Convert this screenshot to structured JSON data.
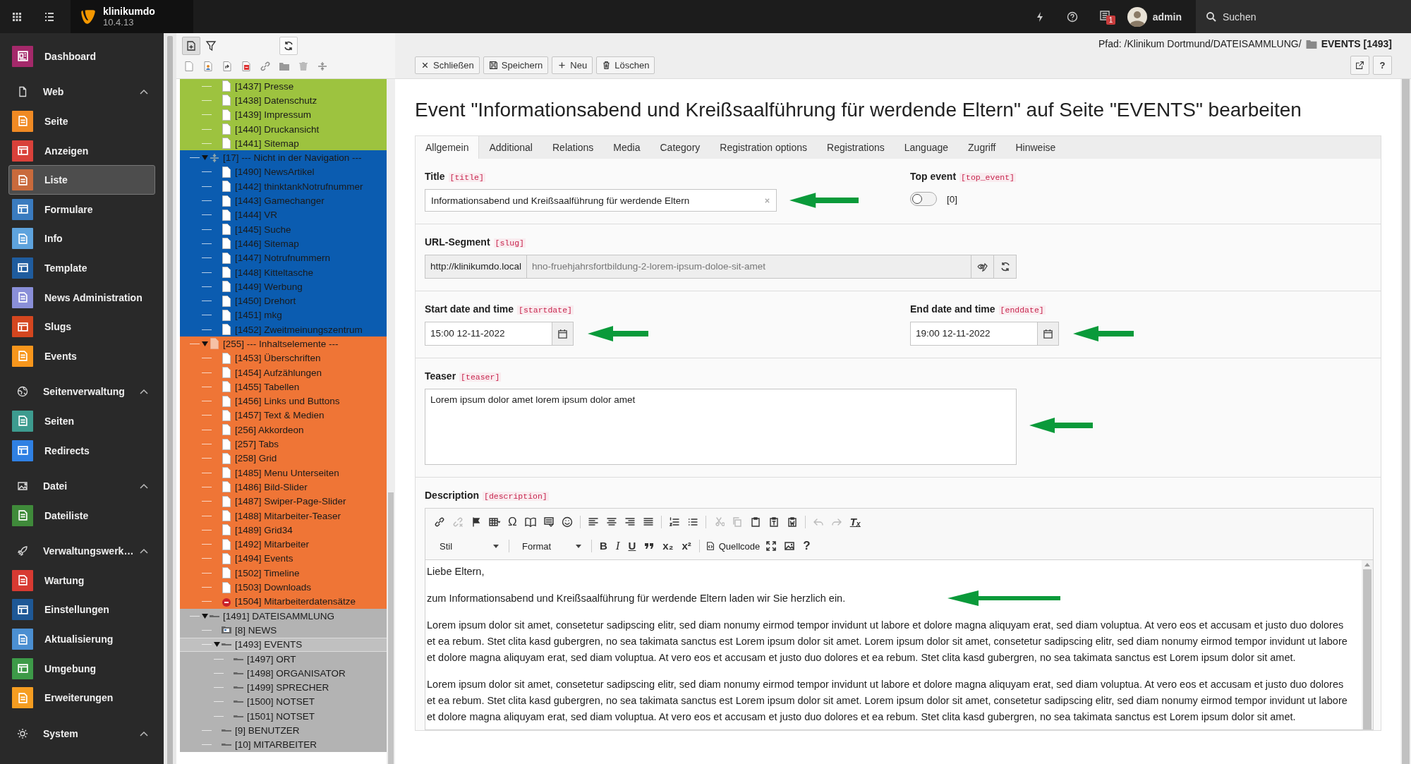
{
  "topbar": {
    "site_name": "klinikumdo",
    "version": "10.4.13",
    "notification_count": "1",
    "user": "admin",
    "search": "Suchen"
  },
  "sidebar": {
    "items": [
      {
        "kind": "module",
        "label": "Dashboard",
        "color": "#a4296a",
        "selected": false
      },
      {
        "kind": "group",
        "label": "Web",
        "expanded": true,
        "children": [
          {
            "label": "Seite",
            "color": "#f08a24",
            "selected": false
          },
          {
            "label": "Anzeigen",
            "color": "#d9413a",
            "selected": false
          },
          {
            "label": "Liste",
            "color": "#c96a3c",
            "selected": true
          },
          {
            "label": "Formulare",
            "color": "#3a7bbf",
            "selected": false
          },
          {
            "label": "Info",
            "color": "#5ea3dd",
            "selected": false
          },
          {
            "label": "Template",
            "color": "#1f5c9e",
            "selected": false
          },
          {
            "label": "News Administration",
            "color": "#8a8fd8",
            "selected": false
          },
          {
            "label": "Slugs",
            "color": "#d4461f",
            "selected": false
          },
          {
            "label": "Events",
            "color": "#f7961c",
            "selected": false
          }
        ]
      },
      {
        "kind": "group",
        "label": "Seitenverwaltung",
        "expanded": true,
        "children": [
          {
            "label": "Seiten",
            "color": "#3d9b8f",
            "selected": false
          },
          {
            "label": "Redirects",
            "color": "#2f80e3",
            "selected": false
          }
        ]
      },
      {
        "kind": "group",
        "label": "Datei",
        "expanded": true,
        "children": [
          {
            "label": "Dateiliste",
            "color": "#3f8a3a",
            "selected": false
          }
        ]
      },
      {
        "kind": "group",
        "label": "Verwaltungswerk…",
        "expanded": true,
        "children": [
          {
            "label": "Wartung",
            "color": "#d73a32",
            "selected": false
          },
          {
            "label": "Einstellungen",
            "color": "#1e5896",
            "selected": false
          },
          {
            "label": "Aktualisierung",
            "color": "#4b8fd1",
            "selected": false
          },
          {
            "label": "Umgebung",
            "color": "#3d9a48",
            "selected": false
          },
          {
            "label": "Erweiterungen",
            "color": "#f59d21",
            "selected": false
          }
        ]
      },
      {
        "kind": "group",
        "label": "System",
        "expanded": true
      }
    ]
  },
  "tree": {
    "cut_branch": {
      "color": "#9dc33f",
      "children": [
        {
          "label": "[1437] Presse",
          "kind": "page",
          "selected": false
        },
        {
          "label": "[1438] Datenschutz",
          "kind": "page",
          "selected": false
        },
        {
          "label": "[1439] Impressum",
          "kind": "page",
          "selected": false
        },
        {
          "label": "[1440] Druckansicht",
          "kind": "page",
          "selected": false
        },
        {
          "label": "[1441] Sitemap",
          "kind": "page",
          "selected": false
        }
      ]
    },
    "nodes": [
      {
        "label": "[17] --- Nicht in der Navigation ---",
        "kind": "spacer",
        "color": "#0b5cb0",
        "expanded": true,
        "selected": false,
        "children": [
          {
            "label": "[1490] NewsArtikel",
            "kind": "page",
            "selected": false
          },
          {
            "label": "[1442] thinktankNotrufnummer",
            "kind": "page",
            "selected": false
          },
          {
            "label": "[1443] Gamechanger",
            "kind": "page",
            "selected": false
          },
          {
            "label": "[1444] VR",
            "kind": "page",
            "selected": false
          },
          {
            "label": "[1445] Suche",
            "kind": "page",
            "selected": false
          },
          {
            "label": "[1446] Sitemap",
            "kind": "page",
            "selected": false
          },
          {
            "label": "[1447] Notrufnummern",
            "kind": "page",
            "selected": false
          },
          {
            "label": "[1448] Kitteltasche",
            "kind": "page",
            "selected": false
          },
          {
            "label": "[1449] Werbung",
            "kind": "page",
            "selected": false
          },
          {
            "label": "[1450] Drehort",
            "kind": "page",
            "selected": false
          },
          {
            "label": "[1451] mkg",
            "kind": "page",
            "selected": false
          },
          {
            "label": "[1452] Zweitmeinungszentrum",
            "kind": "page",
            "selected": false
          }
        ]
      },
      {
        "label": "[255] --- Inhaltselemente ---",
        "kind": "tinted",
        "color": "#ef7536",
        "expanded": true,
        "selected": false,
        "children": [
          {
            "label": "[1453] Überschriften",
            "kind": "page",
            "selected": false
          },
          {
            "label": "[1454] Aufzählungen",
            "kind": "page",
            "selected": false
          },
          {
            "label": "[1455] Tabellen",
            "kind": "page",
            "selected": false
          },
          {
            "label": "[1456] Links und Buttons",
            "kind": "page",
            "selected": false
          },
          {
            "label": "[1457] Text & Medien",
            "kind": "page",
            "selected": false
          },
          {
            "label": "[256] Akkordeon",
            "kind": "page",
            "selected": false
          },
          {
            "label": "[257] Tabs",
            "kind": "page",
            "selected": false
          },
          {
            "label": "[258] Grid",
            "kind": "page",
            "selected": false
          },
          {
            "label": "[1485] Menu Unterseiten",
            "kind": "page",
            "selected": false
          },
          {
            "label": "[1486] Bild-Slider",
            "kind": "page",
            "selected": false
          },
          {
            "label": "[1487] Swiper-Page-Slider",
            "kind": "page",
            "selected": false
          },
          {
            "label": "[1488] Mitarbeiter-Teaser",
            "kind": "page",
            "selected": false
          },
          {
            "label": "[1489] Grid34",
            "kind": "page",
            "selected": false
          },
          {
            "label": "[1492] Mitarbeiter",
            "kind": "page",
            "selected": false
          },
          {
            "label": "[1494] Events",
            "kind": "page",
            "selected": false
          },
          {
            "label": "[1502] Timeline",
            "kind": "page",
            "selected": false
          },
          {
            "label": "[1503] Downloads",
            "kind": "page",
            "selected": false
          },
          {
            "label": "[1504] Mitarbeiterdatensätze",
            "kind": "restricted",
            "selected": false
          }
        ]
      },
      {
        "label": "[1491] DATEISAMMLUNG",
        "kind": "folder",
        "color": "#b3b3b3",
        "expanded": true,
        "selected": false,
        "children": [
          {
            "label": "[8] NEWS",
            "kind": "plugin",
            "selected": false
          },
          {
            "label": "[1493] EVENTS",
            "kind": "folder",
            "expanded": true,
            "selected": true,
            "children": [
              {
                "label": "[1497] ORT",
                "kind": "folder",
                "selected": false
              },
              {
                "label": "[1498] ORGANISATOR",
                "kind": "folder",
                "selected": false
              },
              {
                "label": "[1499] SPRECHER",
                "kind": "folder",
                "selected": false
              },
              {
                "label": "[1500] NOTSET",
                "kind": "folder",
                "selected": false
              },
              {
                "label": "[1501] NOTSET",
                "kind": "folder",
                "selected": false
              }
            ]
          },
          {
            "label": "[9] BENUTZER",
            "kind": "folder",
            "selected": false
          },
          {
            "label": "[10] MITARBEITER",
            "kind": "folder",
            "selected": false
          }
        ]
      }
    ]
  },
  "docheader": {
    "path": "Pfad: /Klinikum Dortmund/DATEISAMMLUNG/",
    "page": "EVENTS [1493]",
    "help": "?",
    "buttons": [
      {
        "kind": "close",
        "label": "Schließen"
      },
      {
        "kind": "save",
        "label": "Speichern"
      },
      {
        "kind": "new",
        "label": "Neu"
      },
      {
        "kind": "delete",
        "label": "Löschen"
      }
    ]
  },
  "heading": "Event \"Informationsabend und Kreißsaalführung für werdende Eltern\" auf Seite \"EVENTS\" bearbeiten",
  "tabs": [
    {
      "label": "Allgemein",
      "selected": true
    },
    {
      "label": "Additional",
      "selected": false
    },
    {
      "label": "Relations",
      "selected": false
    },
    {
      "label": "Media",
      "selected": false
    },
    {
      "label": "Category",
      "selected": false
    },
    {
      "label": "Registration options",
      "selected": false
    },
    {
      "label": "Registrations",
      "selected": false
    },
    {
      "label": "Language",
      "selected": false
    },
    {
      "label": "Zugriff",
      "selected": false
    },
    {
      "label": "Hinweise",
      "selected": false
    }
  ],
  "form": {
    "title": {
      "label": "Title",
      "field": "[title]",
      "value": "Informationsabend und Kreißsaalführung für werdende Eltern"
    },
    "top_event": {
      "label": "Top event",
      "field": "[top_event]",
      "on": false,
      "value_text": "[0]"
    },
    "url_segment": {
      "label": "URL-Segment",
      "field": "[slug]",
      "prefix": "http://klinikumdo.local",
      "value": "hno-fruehjahrsfortbildung-2-lorem-ipsum-doloe-sit-amet"
    },
    "start_date": {
      "label": "Start date and time",
      "field": "[startdate]",
      "value": "15:00 12-11-2022"
    },
    "end_date": {
      "label": "End date and time",
      "field": "[enddate]",
      "value": "19:00 12-11-2022"
    },
    "teaser": {
      "label": "Teaser",
      "field": "[teaser]",
      "value": "Lorem ipsum dolor amet lorem ipsum dolor amet"
    },
    "description": {
      "label": "Description",
      "field": "[description]",
      "toolbar": {
        "special_char": "Ω",
        "remove_format": "Tₓ",
        "style": "Stil",
        "format": "Format",
        "bold": "B",
        "italic": "I",
        "underline": "U",
        "subscript": "x₂",
        "superscript": "x²",
        "source": "Quellcode",
        "help": "?"
      },
      "paragraphs": [
        "Liebe Eltern,",
        "zum  Informationsabend und Kreißsaalführung für werdende Eltern laden wir Sie herzlich ein.",
        "Lorem ipsum dolor sit amet, consetetur sadipscing elitr, sed diam nonumy eirmod tempor invidunt ut labore et dolore magna aliquyam erat, sed diam voluptua. At vero eos et accusam et justo duo dolores et ea rebum. Stet clita kasd gubergren, no sea takimata sanctus est Lorem ipsum dolor sit amet. Lorem ipsum dolor sit amet, consetetur sadipscing elitr, sed diam nonumy eirmod tempor invidunt ut labore et dolore magna aliquyam erat, sed diam voluptua. At vero eos et accusam et justo duo dolores et ea rebum. Stet clita kasd gubergren, no sea takimata sanctus est Lorem ipsum dolor sit amet.",
        "Lorem ipsum dolor sit amet, consetetur sadipscing elitr, sed diam nonumy eirmod tempor invidunt ut labore et dolore magna aliquyam erat, sed diam voluptua. At vero eos et accusam et justo duo dolores et ea rebum. Stet clita kasd gubergren, no sea takimata sanctus est Lorem ipsum dolor sit amet. Lorem ipsum dolor sit amet, consetetur sadipscing elitr, sed diam nonumy eirmod tempor invidunt ut labore et dolore magna aliquyam erat, sed diam voluptua. At vero eos et accusam et justo duo dolores et ea rebum. Stet clita kasd gubergren, no sea takimata sanctus est Lorem ipsum dolor sit amet."
      ]
    }
  }
}
